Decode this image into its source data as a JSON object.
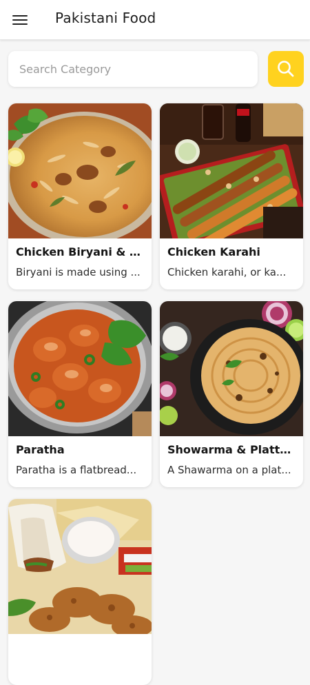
{
  "header": {
    "title": "Pakistani Food",
    "menu_icon": "hamburger-menu-icon"
  },
  "search": {
    "placeholder": "Search Category",
    "value": "",
    "button_icon": "search-icon",
    "button_color": "#ffd21f"
  },
  "categories": [
    {
      "title": "Chicken Biryani & Pul...",
      "description": "Biryani is made using ...",
      "image": "biryani-image"
    },
    {
      "title": "Chicken Karahi",
      "description": "Chicken karahi, or ka...",
      "image": "karahi-image"
    },
    {
      "title": "Paratha",
      "description": "Paratha is a flatbread...",
      "image": "paratha-image"
    },
    {
      "title": "Showarma & Platters",
      "description": "A Shawarma on a plat...",
      "image": "shawarma-image"
    },
    {
      "title": "",
      "description": "",
      "image": "platter-image"
    }
  ]
}
